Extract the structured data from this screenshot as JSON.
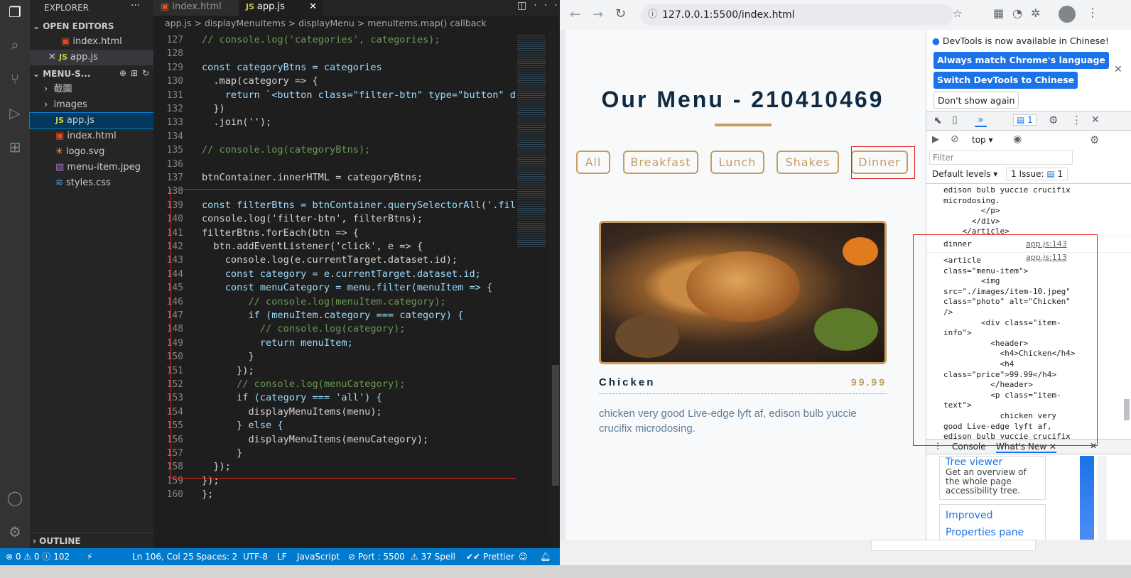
{
  "vscode": {
    "tabs": [
      {
        "label": "index.html",
        "icon": "html5-icon"
      },
      {
        "label": "app.js",
        "icon": "js-icon"
      }
    ],
    "breadcrumbs": [
      "app.js",
      ">",
      "displayMenuItems",
      ">",
      "displayMenu",
      ">",
      "menuItems.map() callback"
    ],
    "explorer": {
      "title": "EXPLORER",
      "open_editors_label": "OPEN EDITORS",
      "open_editors": [
        "index.html",
        "app.js"
      ],
      "project_label": "MENU-S...",
      "files": [
        "截圖",
        "images",
        "app.js",
        "index.html",
        "logo.svg",
        "menu-item.jpeg",
        "styles.css"
      ],
      "outline_label": "OUTLINE"
    },
    "line_numbers": [
      "127",
      "128",
      "129",
      "130",
      "131",
      "132",
      "133",
      "134",
      "135",
      "136",
      "137",
      "138",
      "139",
      "140",
      "141",
      "142",
      "143",
      "144",
      "145",
      "146",
      "147",
      "148",
      "149",
      "150",
      "151",
      "152",
      "153",
      "154",
      "155",
      "156",
      "157",
      "158",
      "159",
      "160"
    ],
    "code_lines": [
      "// console.log('categories', categories);",
      "",
      "const categoryBtns = categories",
      "  .map(category => {",
      "    return `<button class=\"filter-btn\" type=\"button\" d",
      "  })",
      "  .join('');",
      "",
      "// console.log(categoryBtns);",
      "",
      "btnContainer.innerHTML = categoryBtns;",
      "",
      "const filterBtns = btnContainer.querySelectorAll('.fil",
      "console.log('filter-btn', filterBtns);",
      "filterBtns.forEach(btn => {",
      "  btn.addEventListener('click', e => {",
      "    console.log(e.currentTarget.dataset.id);",
      "    const category = e.currentTarget.dataset.id;",
      "    const menuCategory = menu.filter(menuItem => {",
      "        // console.log(menuItem.category);",
      "        if (menuItem.category === category) {",
      "          // console.log(category);",
      "          return menuItem;",
      "        }",
      "      });",
      "      // console.log(menuCategory);",
      "      if (category === 'all') {",
      "        displayMenuItems(menu);",
      "      } else {",
      "        displayMenuItems(menuCategory);",
      "      }",
      "  });",
      "});",
      "};"
    ],
    "status": {
      "errors": "0",
      "warnings": "0",
      "info": "102",
      "position": "Ln 106, Col 25",
      "spaces": "Spaces: 2",
      "encoding": "UTF-8",
      "eol": "LF",
      "language": "JavaScript",
      "port": "Port : 5500",
      "spell": "37 Spell",
      "prettier": "Prettier"
    }
  },
  "browser": {
    "url": "127.0.0.1:5500/index.html",
    "page": {
      "title": "Our Menu - 210410469",
      "filters": [
        "All",
        "Breakfast",
        "Lunch",
        "Shakes",
        "Dinner"
      ],
      "item_name": "Chicken",
      "item_price": "99.99",
      "item_text": "chicken very good Live-edge lyft af, edison bulb yuccie crucifix microdosing."
    },
    "devtools": {
      "notice": "DevTools is now available in Chinese!",
      "btn_match": "Always match Chrome's language",
      "btn_switch": "Switch DevTools to Chinese",
      "btn_dont_show": "Don't show again",
      "issue_count": "1",
      "context": "top",
      "filter_placeholder": "Filter",
      "levels": "Default levels",
      "issues_label": "1 Issue:",
      "issues_count": "1",
      "console_top_lines": [
        "edison bulb yuccie crucifix",
        "microdosing.",
        "        </p>",
        "      </div>",
        "    </article>"
      ],
      "log_dinner": "dinner",
      "log_dinner_src": "app.js:143",
      "log_article_src": "app.js:113",
      "console_lines": [
        "<article",
        "class=\"menu-item\">",
        "        <img",
        "src=\"./images/item-10.jpeg\"",
        "class=\"photo\" alt=\"Chicken\"",
        "/>",
        "        <div class=\"item-",
        "info\">",
        "          <header>",
        "            <h4>Chicken</h4>",
        "            <h4",
        "class=\"price\">99.99</h4>",
        "          </header>",
        "          <p class=\"item-",
        "text\">",
        "            chicken very",
        "good Live-edge lyft af,",
        "edison bulb yuccie crucifix"
      ],
      "drawer_tabs": [
        "Console",
        "What's New"
      ],
      "whatsnew": {
        "tree_viewer": "Tree viewer",
        "tree_desc": "Get an overview of the whole page accessibility tree.",
        "improved": "Improved Properties pane"
      }
    }
  }
}
